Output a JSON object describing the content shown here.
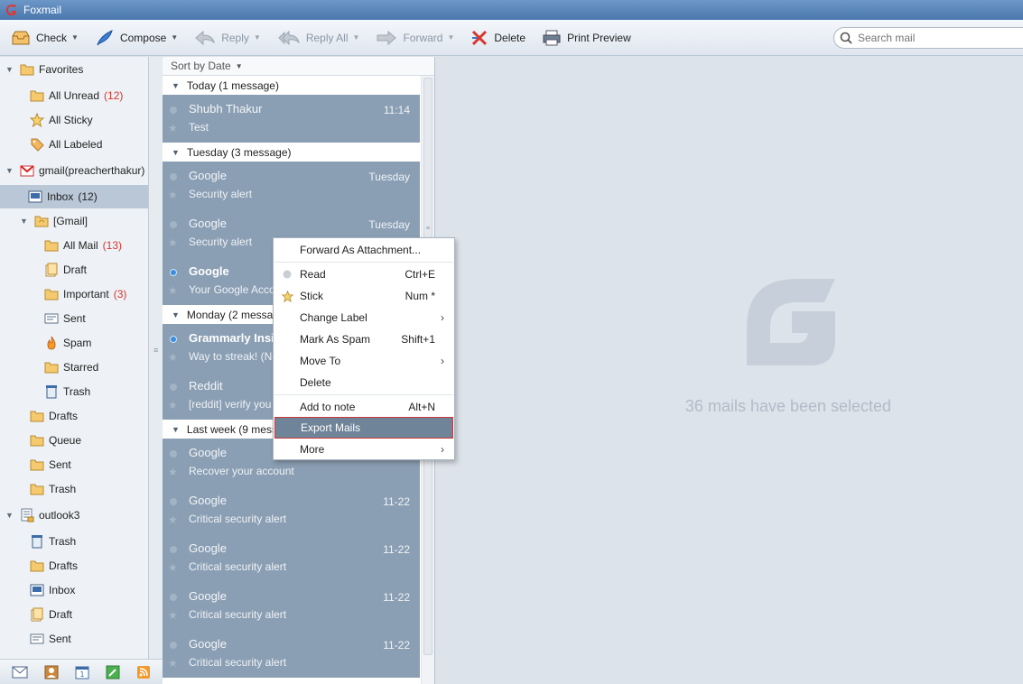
{
  "app": {
    "title": "Foxmail"
  },
  "toolbar": {
    "check": "Check",
    "compose": "Compose",
    "reply": "Reply",
    "reply_all": "Reply All",
    "forward": "Forward",
    "delete": "Delete",
    "print_preview": "Print Preview",
    "search_placeholder": "Search mail"
  },
  "sidebar": {
    "favorites": {
      "label": "Favorites",
      "items": [
        {
          "label": "All Unread",
          "count": "(12)"
        },
        {
          "label": "All Sticky"
        },
        {
          "label": "All Labeled"
        }
      ]
    },
    "gmail": {
      "label": "gmail(preacherthakur)",
      "inbox": {
        "label": "Inbox",
        "count": "(12)"
      },
      "gmail_folder": {
        "label": "[Gmail]",
        "items": [
          {
            "label": "All Mail",
            "count": "(13)"
          },
          {
            "label": "Draft"
          },
          {
            "label": "Important",
            "count": "(3)"
          },
          {
            "label": "Sent"
          },
          {
            "label": "Spam"
          },
          {
            "label": "Starred"
          },
          {
            "label": "Trash"
          }
        ]
      },
      "items": [
        {
          "label": "Drafts"
        },
        {
          "label": "Queue"
        },
        {
          "label": "Sent"
        },
        {
          "label": "Trash"
        }
      ]
    },
    "outlook": {
      "label": "outlook3",
      "items": [
        {
          "label": "Trash"
        },
        {
          "label": "Drafts"
        },
        {
          "label": "Inbox"
        },
        {
          "label": "Draft"
        },
        {
          "label": "Sent"
        }
      ]
    }
  },
  "maillist": {
    "sort_label": "Sort by Date",
    "groups": [
      {
        "label": "Today (1 message)"
      },
      {
        "label": "Tuesday (3 message)"
      },
      {
        "label": "Monday (2 messa"
      },
      {
        "label": "Last week (9 mess"
      }
    ],
    "messages": [
      {
        "sender": "Shubh Thakur",
        "date": "11:14",
        "subject": "Test"
      },
      {
        "sender": "Google",
        "date": "Tuesday",
        "subject": "Security alert"
      },
      {
        "sender": "Google",
        "date": "Tuesday",
        "subject": "Security alert"
      },
      {
        "sender": "Google",
        "date": "",
        "subject": "Your Google Accc"
      },
      {
        "sender": "Grammarly Insi",
        "date": "",
        "subject": "Way to streak! (Nc"
      },
      {
        "sender": "Reddit",
        "date": "",
        "subject": "[reddit] verify you"
      },
      {
        "sender": "Google",
        "date": "",
        "subject": "Recover your account"
      },
      {
        "sender": "Google",
        "date": "11-22",
        "subject": "Critical security alert"
      },
      {
        "sender": "Google",
        "date": "11-22",
        "subject": "Critical security alert"
      },
      {
        "sender": "Google",
        "date": "11-22",
        "subject": "Critical security alert"
      },
      {
        "sender": "Google",
        "date": "11-22",
        "subject": "Critical security alert"
      }
    ]
  },
  "context_menu": {
    "items": [
      {
        "label": "Forward As Attachment...",
        "shortcut": ""
      },
      {
        "label": "Read",
        "shortcut": "Ctrl+E"
      },
      {
        "label": "Stick",
        "shortcut": "Num *"
      },
      {
        "label": "Change Label",
        "shortcut": ""
      },
      {
        "label": "Mark As Spam",
        "shortcut": "Shift+1"
      },
      {
        "label": "Move To",
        "shortcut": ""
      },
      {
        "label": "Delete",
        "shortcut": ""
      },
      {
        "label": "Add to note",
        "shortcut": "Alt+N"
      },
      {
        "label": "Export Mails",
        "shortcut": ""
      },
      {
        "label": "More",
        "shortcut": ""
      }
    ]
  },
  "preview": {
    "selection_message": "36 mails have been selected"
  },
  "colors": {
    "accent": "#4a78ad",
    "unread_count": "#d9352b",
    "selected_mail": "#8b9fb4",
    "highlight_border": "#c93a3a"
  }
}
